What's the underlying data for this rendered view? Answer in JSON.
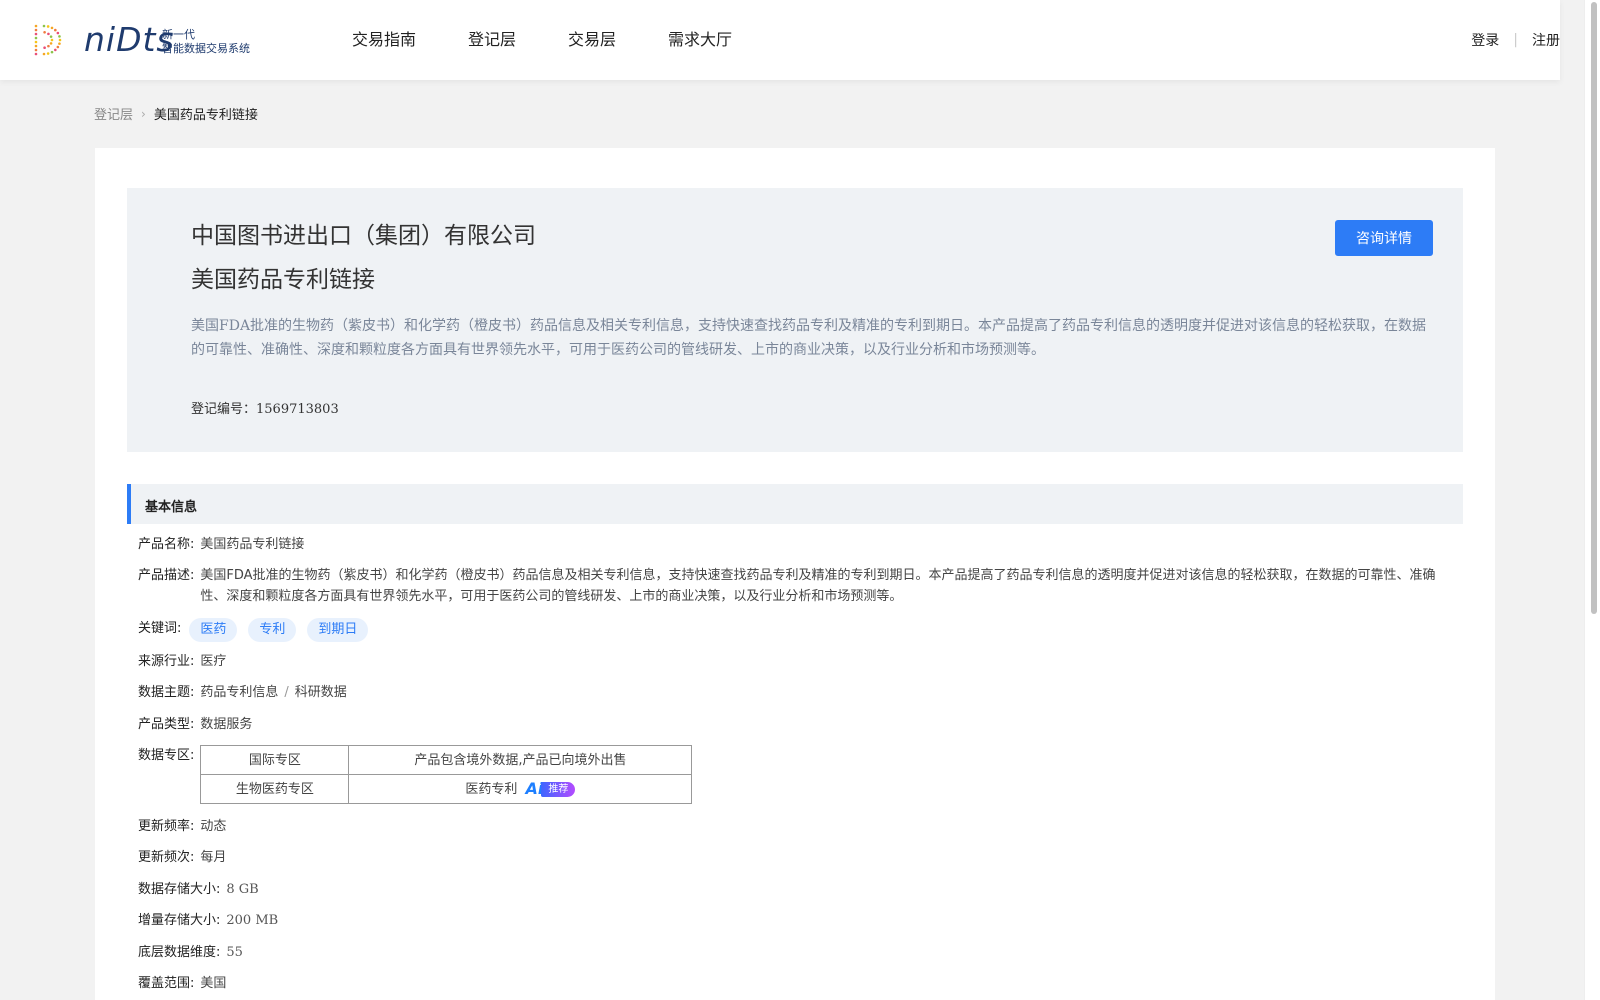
{
  "header": {
    "logo_word": "niDts",
    "logo_sub_line1": "新一代",
    "logo_sub_line2": "智能数据交易系统",
    "nav": [
      "交易指南",
      "登记层",
      "交易层",
      "需求大厅"
    ],
    "login": "登录",
    "register": "注册"
  },
  "breadcrumb": {
    "parent": "登记层",
    "current": "美国药品专利链接"
  },
  "hero": {
    "company": "中国图书进出口（集团）有限公司",
    "title": "美国药品专利链接",
    "description": "美国FDA批准的生物药（紫皮书）和化学药（橙皮书）药品信息及相关专利信息，支持快速查找药品专利及精准的专利到期日。本产品提高了药品专利信息的透明度并促进对该信息的轻松获取，在数据的可靠性、准确性、深度和颗粒度各方面具有世界领先水平，可用于医药公司的管线研发、上市的商业决策，以及行业分析和市场预测等。",
    "reg_label": "登记编号：",
    "reg_number": "1569713803",
    "consult_button": "咨询详情"
  },
  "basic_info": {
    "section_title": "基本信息",
    "product_name_label": "产品名称:",
    "product_name": "美国药品专利链接",
    "product_desc_label": "产品描述:",
    "product_desc": "美国FDA批准的生物药（紫皮书）和化学药（橙皮书）药品信息及相关专利信息，支持快速查找药品专利及精准的专利到期日。本产品提高了药品专利信息的透明度并促进对该信息的轻松获取，在数据的可靠性、准确性、深度和颗粒度各方面具有世界领先水平，可用于医药公司的管线研发、上市的商业决策，以及行业分析和市场预测等。",
    "keywords_label": "关键词:",
    "keywords": [
      "医药",
      "专利",
      "到期日"
    ],
    "industry_label": "来源行业:",
    "industry": "医疗",
    "theme_label": "数据主题:",
    "theme_1": "药品专利信息",
    "theme_sep": "/",
    "theme_2": "科研数据",
    "type_label": "产品类型:",
    "type": "数据服务",
    "zone_label": "数据专区:",
    "zones": [
      {
        "zone": "国际专区",
        "detail": "产品包含境外数据,产品已向境外出售"
      },
      {
        "zone": "生物医药专区",
        "detail": "医药专利"
      }
    ],
    "ai_mark": "Ai",
    "ai_tag": "推荐",
    "update_rate_label": "更新频率:",
    "update_rate": "动态",
    "update_freq_label": "更新频次:",
    "update_freq": "每月",
    "storage_label": "数据存储大小:",
    "storage": "8 GB",
    "increment_label": "增量存储大小:",
    "increment": "200 MB",
    "dimension_label": "底层数据维度:",
    "dimension": "55",
    "coverage_label": "覆盖范围:",
    "coverage": "美国"
  },
  "colors": {
    "accent": "#2d7cf6",
    "hero_bg": "#eff2f5",
    "page_bg": "#f2f2f2"
  }
}
